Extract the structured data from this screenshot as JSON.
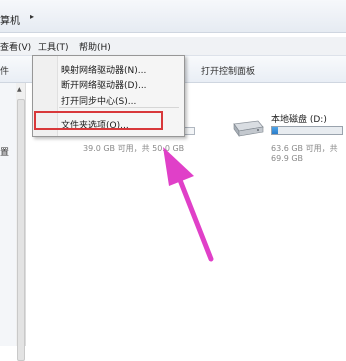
{
  "address": {
    "text": "算机",
    "arrow": "▸"
  },
  "menubar": {
    "items": [
      {
        "label": "查看(V)"
      },
      {
        "label": "工具(T)"
      },
      {
        "label": "帮助(H)"
      }
    ]
  },
  "toolbar": {
    "left_fragment": "件",
    "control_panel": "打开控制面板"
  },
  "left_label": "置",
  "dropdown": {
    "items": [
      {
        "label": "映射网络驱动器(N)..."
      },
      {
        "label": "断开网络驱动器(D)..."
      },
      {
        "label": "打开同步中心(S)..."
      },
      {
        "label": "文件夹选项(O)..."
      }
    ]
  },
  "drive_c": {
    "free_text": "39.0 GB 可用，共 50.0 GB"
  },
  "drive_d": {
    "name": "本地磁盘 (D:)",
    "free_text": "63.6 GB 可用，共 69.9 GB",
    "used_fraction": 0.09
  },
  "colors": {
    "accent": "#e040c8",
    "highlight": "#d8383a"
  }
}
